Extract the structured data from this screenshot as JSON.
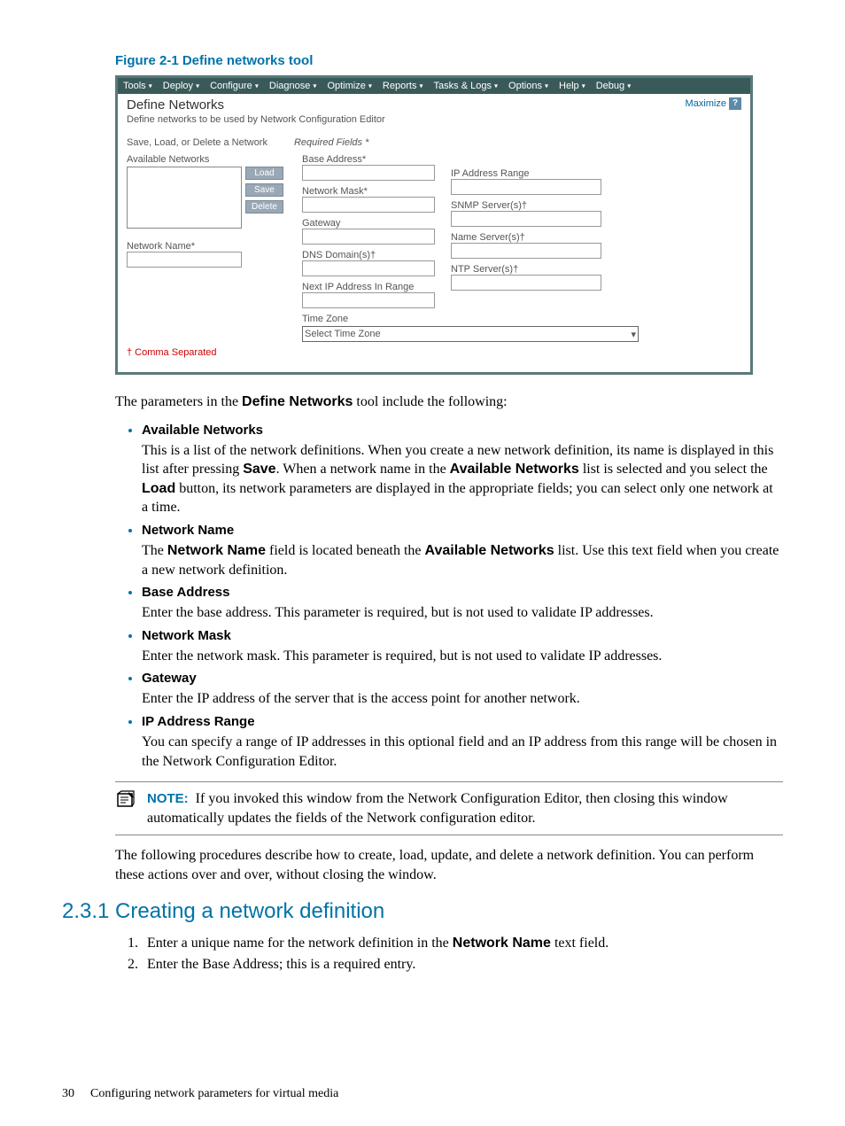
{
  "figure_caption": "Figure 2-1 Define networks tool",
  "screenshot": {
    "menu": [
      "Tools",
      "Deploy",
      "Configure",
      "Diagnose",
      "Optimize",
      "Reports",
      "Tasks & Logs",
      "Options",
      "Help",
      "Debug"
    ],
    "title": "Define Networks",
    "subtitle": "Define networks to be used by Network Configuration Editor",
    "maximize": "Maximize",
    "save_load_label": "Save, Load, or Delete a Network",
    "required_fields": "Required Fields *",
    "available_networks_label": "Available Networks",
    "network_name_label": "Network Name*",
    "btn_load": "Load",
    "btn_save": "Save",
    "btn_delete": "Delete",
    "base_address_label": "Base Address*",
    "network_mask_label": "Network Mask*",
    "gateway_label": "Gateway",
    "dns_domain_label": "DNS Domain(s)†",
    "next_ip_label": "Next IP Address In Range",
    "time_zone_label": "Time Zone",
    "time_zone_value": "Select Time Zone",
    "ip_range_label": "IP Address Range",
    "snmp_label": "SNMP Server(s)†",
    "name_server_label": "Name Server(s)†",
    "ntp_label": "NTP Server(s)†",
    "comma_sep": "† Comma Separated"
  },
  "intro_text_pre": "The parameters in the ",
  "intro_text_bold": "Define Networks",
  "intro_text_post": " tool include the following:",
  "params": [
    {
      "head": "Available Networks",
      "body_parts": [
        {
          "t": "This is a list of the network definitions. When you create a new network definition, its name is displayed in this list after pressing "
        },
        {
          "b": "Save"
        },
        {
          "t": ". When a network name in the "
        },
        {
          "b": "Available Networks"
        },
        {
          "t": " list is selected and you select the "
        },
        {
          "b": "Load"
        },
        {
          "t": " button, its network parameters are displayed in the appropriate fields; you can select only one network at a time."
        }
      ]
    },
    {
      "head": "Network Name",
      "body_parts": [
        {
          "t": "The "
        },
        {
          "b": "Network Name"
        },
        {
          "t": " field is located beneath the "
        },
        {
          "b": "Available Networks"
        },
        {
          "t": " list. Use this text field when you create a new network definition."
        }
      ]
    },
    {
      "head": "Base Address",
      "body_parts": [
        {
          "t": "Enter the base address. This parameter is required, but is not used to validate IP addresses."
        }
      ]
    },
    {
      "head": "Network Mask",
      "body_parts": [
        {
          "t": "Enter the network mask. This parameter is required, but is not used to validate IP addresses."
        }
      ]
    },
    {
      "head": "Gateway",
      "body_parts": [
        {
          "t": "Enter the IP address of the server that is the access point for another network."
        }
      ]
    },
    {
      "head": "IP Address Range",
      "body_parts": [
        {
          "t": "You can specify a range of IP addresses in this optional field and an IP address from this range will be chosen in the Network Configuration Editor."
        }
      ]
    }
  ],
  "note_label": "NOTE:",
  "note_text": "If you invoked this window from the Network Configuration Editor, then closing this window automatically updates the fields of the Network configuration editor.",
  "after_note": "The following procedures describe how to create, load, update, and delete a network definition. You can perform these actions over and over, without closing the window.",
  "section_heading": "2.3.1 Creating a network definition",
  "steps": [
    {
      "parts": [
        {
          "t": "Enter a unique name for the network definition in the "
        },
        {
          "b": "Network Name"
        },
        {
          "t": " text field."
        }
      ]
    },
    {
      "parts": [
        {
          "t": "Enter the Base Address; this is a required entry."
        }
      ]
    }
  ],
  "footer_page": "30",
  "footer_text": "Configuring network parameters for virtual media"
}
